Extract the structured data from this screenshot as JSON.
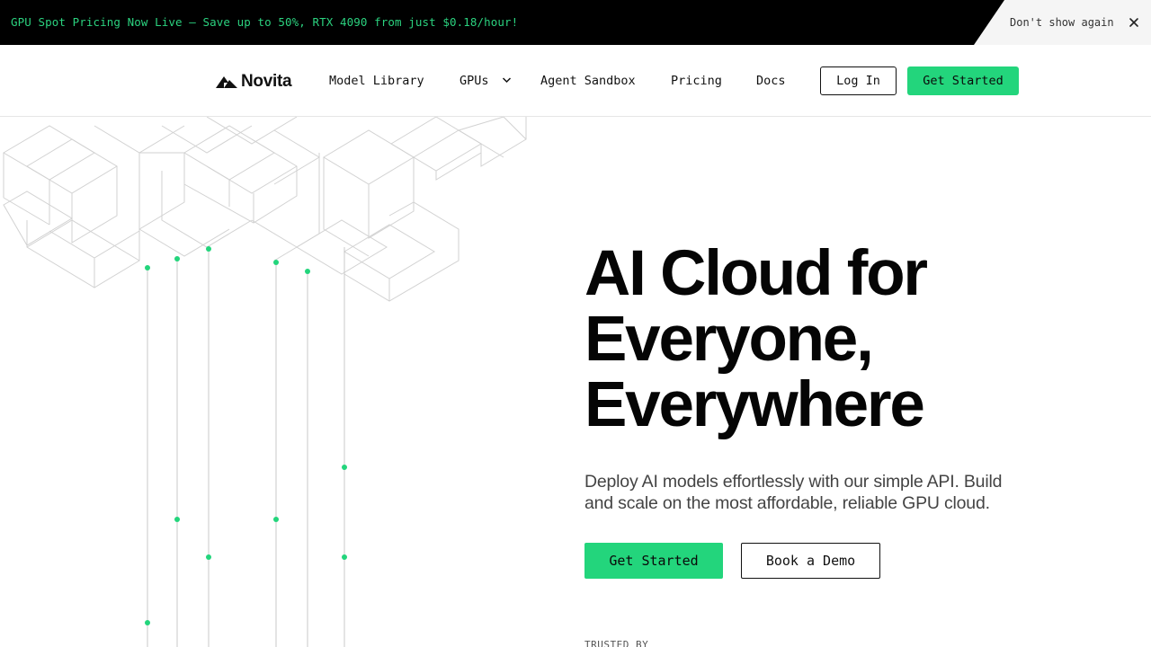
{
  "announcement": {
    "text": "GPU Spot Pricing Now Live – Save up to 50%, RTX 4090 from just $0.18/hour!",
    "dismiss_label": "Don't show again",
    "close_icon": "close-icon"
  },
  "nav": {
    "logo_text": "Novita",
    "links": [
      "Model Library",
      "GPUs",
      "Agent Sandbox",
      "Pricing",
      "Docs"
    ],
    "login_label": "Log In",
    "get_started_label": "Get Started"
  },
  "hero": {
    "title_lines": [
      "AI Cloud for",
      "Everyone,",
      "Everywhere"
    ],
    "subtitle": "Deploy AI models effortlessly with our simple API. Build and scale on the most affordable, reliable GPU cloud.",
    "primary_cta": "Get Started",
    "secondary_cta": "Book a Demo",
    "trusted_label": "TRUSTED BY"
  },
  "colors": {
    "accent": "#23d57c",
    "announcement_bg": "#000000",
    "announcement_text": "#2bd27f"
  }
}
